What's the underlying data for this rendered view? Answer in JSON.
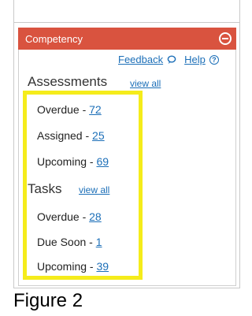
{
  "panel": {
    "title": "Competency",
    "colors": {
      "header": "#d9533f",
      "link": "#1c6fb8",
      "highlight": "#f5ec1b"
    }
  },
  "links": {
    "feedback": "Feedback",
    "help": "Help"
  },
  "assessments": {
    "title": "Assessments",
    "view_all": "view all",
    "items": [
      {
        "label": "Overdue - ",
        "count": "72"
      },
      {
        "label": "Assigned - ",
        "count": "25"
      },
      {
        "label": "Upcoming - ",
        "count": "69"
      }
    ]
  },
  "tasks": {
    "title": "Tasks",
    "view_all": "view all",
    "items": [
      {
        "label": "Overdue - ",
        "count": "28"
      },
      {
        "label": "Due Soon - ",
        "count": "1"
      },
      {
        "label": "Upcoming - ",
        "count": "39"
      }
    ]
  },
  "caption": "Figure 2"
}
